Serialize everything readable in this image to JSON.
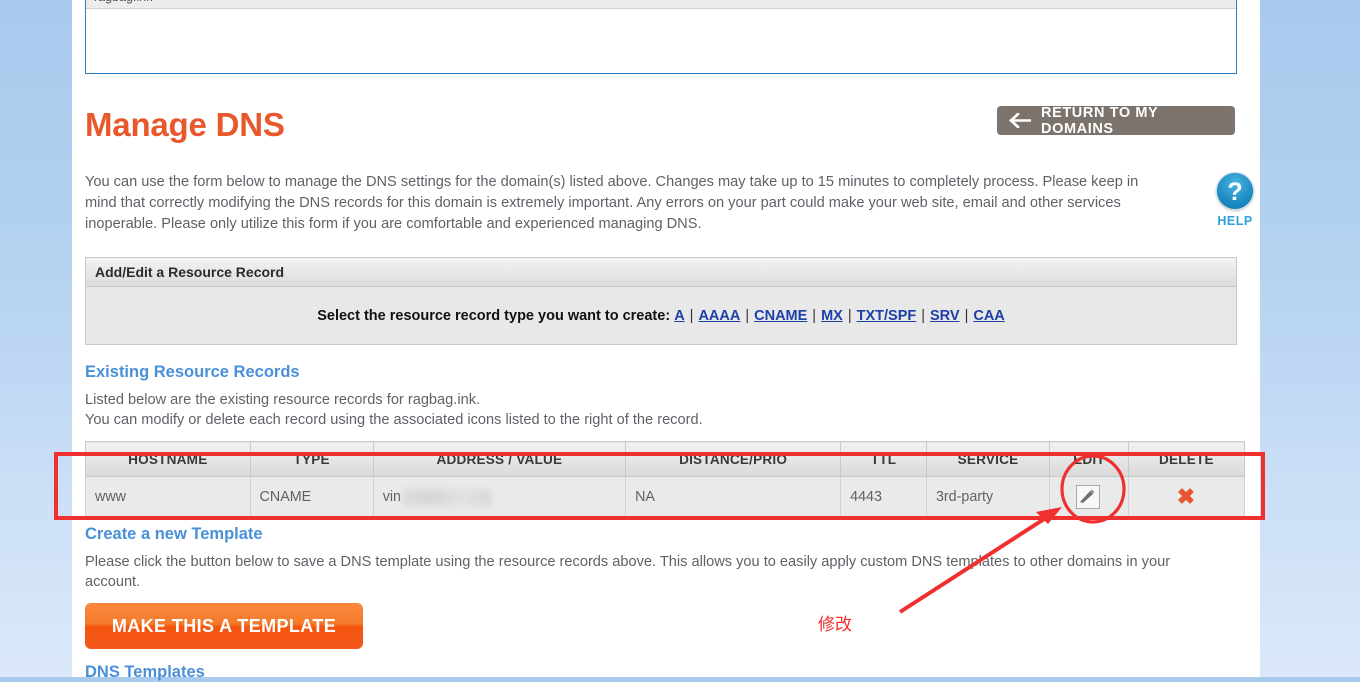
{
  "domain_box": {
    "domain": "ragbag.ink"
  },
  "header": {
    "title": "Manage DNS",
    "return_button": "RETURN TO MY DOMAINS",
    "return_icon": "arrow-left-icon"
  },
  "intro": {
    "text": "You can use the form below to manage the DNS settings for the domain(s) listed above. Changes may take up to 15 minutes to completely process. Please keep in mind that correctly modifying the DNS records for this domain is extremely important. Any errors on your part could make your web site, email and other services inoperable. Please only utilize this form if you are comfortable and experienced managing DNS."
  },
  "help": {
    "icon": "question-mark-icon",
    "glyph": "?",
    "label": "HELP",
    "color": "#2fa2dd"
  },
  "resource_panel": {
    "header": "Add/Edit a Resource Record",
    "prompt": "Select the resource record type you want to create:",
    "types": [
      "A",
      "AAAA",
      "CNAME",
      "MX",
      "TXT/SPF",
      "SRV",
      "CAA"
    ],
    "separator": "|"
  },
  "existing": {
    "heading": "Existing Resource Records",
    "line1": "Listed below are the existing resource records for ragbag.ink.",
    "line2": "You can modify or delete each record using the associated icons listed to the right of the record.",
    "columns": [
      "HOSTNAME",
      "TYPE",
      "ADDRESS / VALUE",
      "DISTANCE/PRIO",
      "TTL",
      "SERVICE",
      "EDIT",
      "DELETE"
    ],
    "rows": [
      {
        "hostname": "www",
        "type": "CNAME",
        "address": "vin",
        "address_redacted": true,
        "distance": "NA",
        "ttl": "4443",
        "service": "3rd-party",
        "edit_icon": "pencil-edit-icon",
        "delete_icon": "red-x-delete-icon",
        "delete_glyph": "✖"
      }
    ]
  },
  "template": {
    "heading": "Create a new Template",
    "text": "Please click the button below to save a DNS template using the resource records above. This allows you to easily apply custom DNS templates to other domains in your account.",
    "button": "MAKE THIS A TEMPLATE"
  },
  "dns_templates": {
    "heading": "DNS Templates"
  },
  "annotations": {
    "callout_text": "修改",
    "color": "#f02f2f"
  }
}
